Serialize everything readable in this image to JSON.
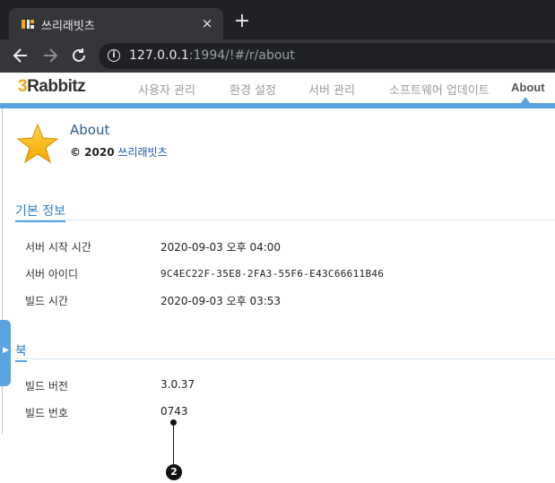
{
  "browser": {
    "tab_title": "쓰리래빗츠",
    "tab_close": "×",
    "new_tab": "+",
    "back_icon": "arrow-left",
    "forward_icon": "arrow-right",
    "reload_icon": "reload",
    "url_host": "127.0.0.1",
    "url_rest": ":1994/!#/r/about"
  },
  "header": {
    "logo_prefix": "3",
    "logo_text": "Rabbitz",
    "nav": [
      {
        "label": "사용자 관리"
      },
      {
        "label": "환경 설정"
      },
      {
        "label": "서버 관리"
      },
      {
        "label": "소프트웨어 업데이트"
      },
      {
        "label": "About"
      }
    ],
    "accent_color": "#5aa3e0"
  },
  "about": {
    "title": "About",
    "copyright_prefix": "© 2020",
    "company": "쓰리래빗츠"
  },
  "sections": {
    "basic": {
      "title": "기본 정보",
      "rows": [
        {
          "label": "서버 시작 시간",
          "value": "2020-09-03 오후 04:00"
        },
        {
          "label": "서버 아이디",
          "value": "9C4EC22F-35E8-2FA3-55F6-E43C66611B46"
        },
        {
          "label": "빌드 시간",
          "value": "2020-09-03 오후 03:53"
        }
      ]
    },
    "book": {
      "title": "북",
      "rows": [
        {
          "label": "빌드 버전",
          "value": "3.0.37"
        },
        {
          "label": "빌드 번호",
          "value": "0743"
        }
      ]
    }
  },
  "callout": {
    "number": "2"
  }
}
